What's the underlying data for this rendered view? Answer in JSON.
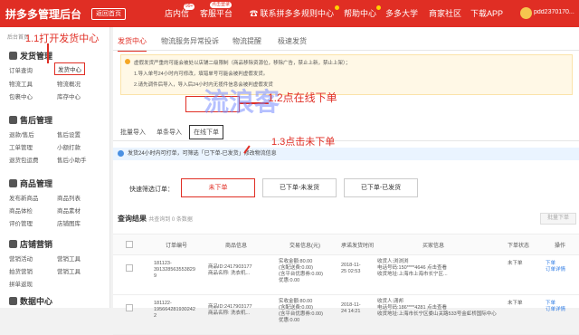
{
  "topbar": {
    "logo": "拼多多管理后台",
    "home_btn": "返回首页",
    "nav": [
      {
        "label": "店内信",
        "badge": "99+"
      },
      {
        "label": "客服平台",
        "badge": "点击登录"
      },
      {
        "label": "联系拼多多",
        "badge": ""
      },
      {
        "label": "规则中心",
        "badge": ""
      },
      {
        "label": "帮助中心",
        "badge": ""
      },
      {
        "label": "多多大学",
        "badge": ""
      },
      {
        "label": "商家社区",
        "badge": ""
      },
      {
        "label": "下载APP",
        "badge": ""
      }
    ],
    "user": "pdd2370170..."
  },
  "sidebar": {
    "crumb": "后台首页",
    "sections": [
      {
        "title": "发货管理",
        "items": [
          "订单查询",
          "发货中心",
          "物流工具",
          "物流概况",
          "包裹中心",
          "库存中心"
        ]
      },
      {
        "title": "售后管理",
        "items": [
          "退款/售后",
          "售后设置",
          "工单管理",
          "小额打款",
          "退货包运费",
          "售后小助手"
        ]
      },
      {
        "title": "商品管理",
        "items": [
          "发布新商品",
          "商品列表",
          "商品体检",
          "商品素材",
          "评价管理",
          "店铺图库"
        ]
      },
      {
        "title": "店铺营销",
        "items": [
          "营销活动",
          "营销工具",
          "拍货营销",
          "营销工具",
          "拼单返现",
          ""
        ]
      },
      {
        "title": "数据中心",
        "items": []
      }
    ]
  },
  "annotations": {
    "step1": "1.1打开发货中心",
    "step2": "1.2点在线下单",
    "step3": "1.3点击未下单",
    "watermark": "流浪客"
  },
  "main": {
    "tabs": [
      "发货中心",
      "物流服务异常投诉",
      "物流提醒",
      "极速发货"
    ],
    "notice": [
      "虚假发货严重的可能会被处以店铺二级限制（商品移除资源位，移除广告，禁止上新，禁止上架）；",
      "1.导入单号24小时内可修改，填错单号可能会被判虚假发货。",
      "2.请先调件后导入，导入后24小时内无揽件信息会被判虚假发货"
    ],
    "subtabs": [
      "批量导入",
      "单条导入",
      "在线下单"
    ],
    "info": "发货24小时内可打单，可筛选「已下单-已发货」修改物流信息",
    "filter_label": "快速筛选订单：",
    "filters": [
      "未下单",
      "已下单-未发货",
      "已下单-已发货"
    ],
    "results_title": "查询结果",
    "results_count": "共查询到 0 条数据",
    "batch_btn": "批量下单",
    "columns": [
      "订单编号",
      "商品信息",
      "交易信息(元)",
      "承诺发货时间",
      "买家信息",
      "下单状态",
      "操作"
    ],
    "rows": [
      {
        "order": [
          "181123-",
          "391328563553829",
          "9"
        ],
        "goods": [
          "商品ID:2417903177",
          "商品名称: 洗衣机..."
        ],
        "trade": [
          "实收金额:80.00",
          "(含配送费:0.00)",
          "(含平台优惠券:0.00)",
          "优惠:0.00"
        ],
        "time": [
          "2018-11-",
          "25 02:53"
        ],
        "buyer": [
          "收货人:浏浏浏",
          "电话号码:150****4646 点击查看",
          "收货地址:上海市上海市长宁区..."
        ],
        "status": "未下单",
        "ops": [
          "下单",
          "订单详情"
        ]
      },
      {
        "order": [
          "181122-",
          "195664281930242",
          "2"
        ],
        "goods": [
          "商品ID:2417903177",
          "商品名称: 洗衣机..."
        ],
        "trade": [
          "实收金额:80.00",
          "(含配送费:0.00)",
          "(含平台优惠券:0.00)",
          "优惠:0.00"
        ],
        "time": [
          "2018-11-",
          "24 14:21"
        ],
        "buyer": [
          "收货人:潇邦",
          "电话号码:186****4281 点击查看",
          "收货地址:上海市长宁区娄山关路533号金虹桥国际中心"
        ],
        "status": "未下单",
        "ops": [
          "下单",
          "订单详情"
        ]
      }
    ]
  },
  "colors": {
    "brand": "#e02e24",
    "link": "#2d7be5"
  }
}
